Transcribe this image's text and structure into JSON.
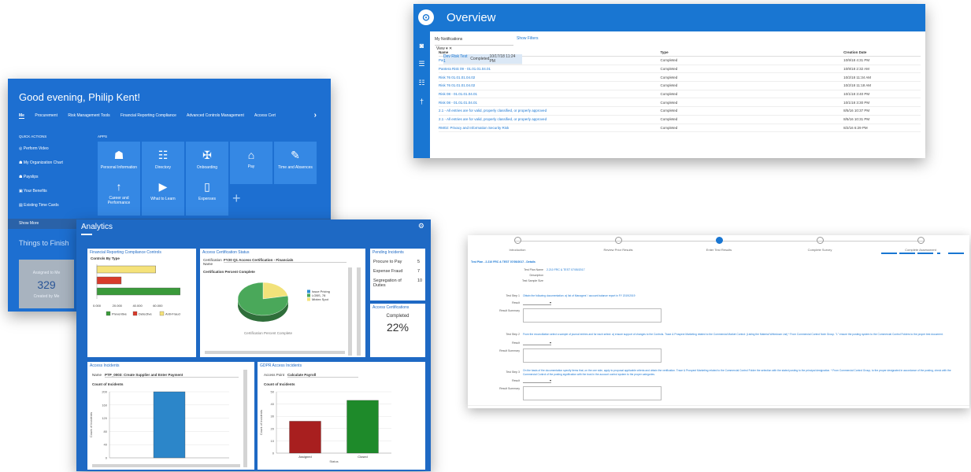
{
  "overview": {
    "title": "Overview",
    "logo_glyph": "⊙",
    "rail_icons": [
      "notification-icon",
      "list-icon",
      "group-icon",
      "person-icon"
    ],
    "rail_glyphs": [
      "◙",
      "☰",
      "☷",
      "†"
    ],
    "notifications_select": "My Notifications",
    "show_filters": "Show Filters",
    "view_label": "View ▾  ✕",
    "columns": [
      "Name",
      "Type",
      "Creation Date"
    ],
    "rows": [
      {
        "name": "Dev Risk Test 1",
        "type": "Completed",
        "date": "10/17/18 11:24 PM"
      },
      {
        "name": "Pantera Risk 08 - 01.01.01.04.01",
        "type": "Completed",
        "date": "10/9/18 4:31 PM"
      },
      {
        "name": "Pantera Risk 09 - 01.01.01.04.01",
        "type": "Completed",
        "date": "10/9/18 2:32 AM"
      },
      {
        "name": "Risk 76 01.01.01.04.02",
        "type": "Completed",
        "date": "10/2/18 11:34 AM"
      },
      {
        "name": "Risk 76 01.01.01.04.02",
        "type": "Completed",
        "date": "10/2/18 11:18 AM"
      },
      {
        "name": "Risk 08 - 01.01.01.04.01",
        "type": "Completed",
        "date": "10/1/18 3:40 PM"
      },
      {
        "name": "Risk 08 - 01.01.01.04.01",
        "type": "Completed",
        "date": "10/1/18 3:30 PM"
      },
      {
        "name": "2.1 - All entries are for valid, properly classified, or properly approved",
        "type": "Completed",
        "date": "8/5/16 10:37 PM"
      },
      {
        "name": "2.1 - All entries are for valid, properly classified, or properly approved",
        "type": "Completed",
        "date": "8/5/16 10:31 PM"
      },
      {
        "name": "RM02: Privacy and Information Security Risk",
        "type": "Completed",
        "date": "8/2/16 6:29 PM"
      }
    ]
  },
  "home": {
    "greeting": "Good evening, Philip Kent!",
    "tabs": [
      "Me",
      "Procurement",
      "Risk Management Tools",
      "Financial Reporting Compliance",
      "Advanced Controls Management",
      "Access Cert"
    ],
    "tabs_arrow": "›",
    "quick_actions_heading": "QUICK ACTIONS",
    "quick_actions": [
      {
        "label": "Perform Video",
        "icon": "◎"
      },
      {
        "label": "My Organization Chart",
        "icon": "☗"
      },
      {
        "label": "Payslips",
        "icon": "☗"
      },
      {
        "label": "Your Benefits",
        "icon": "▣"
      },
      {
        "label": "Existing Time Cards",
        "icon": "▤"
      }
    ],
    "apps_heading": "APPS",
    "tiles": [
      {
        "label": "Personal Information",
        "icon": "☗"
      },
      {
        "label": "Directory",
        "icon": "☷"
      },
      {
        "label": "Onboarding",
        "icon": "✠"
      },
      {
        "label": "Pay",
        "icon": "⌂"
      },
      {
        "label": "Time and Absences",
        "icon": "✎"
      },
      {
        "label": "Career and Performance",
        "icon": "↑"
      },
      {
        "label": "What to Learn",
        "icon": "▶"
      },
      {
        "label": "Expenses",
        "icon": "▯"
      }
    ],
    "plus": "+",
    "show_more": "Show More",
    "things_to_finish": "Things to Finish",
    "card_title": "Assigned to Me",
    "card_count": "329",
    "card_sub": "Created by Me"
  },
  "analytics": {
    "title": "Analytics",
    "gear": "⚙",
    "frc": {
      "title": "Financial Reporting Compliance Controls",
      "subtitle": "Controls By Type",
      "chart_data": {
        "type": "bar",
        "orientation": "horizontal",
        "categories": [
          "Anti-Fraud",
          "Detective",
          "Preventive"
        ],
        "series": [
          {
            "name": "Preventive",
            "values": [
              0,
              0,
              82000
            ],
            "color": "#3a9a3a"
          },
          {
            "name": "Detective",
            "values": [
              0,
              24000,
              0
            ],
            "color": "#d83a2a"
          },
          {
            "name": "Anti-Fraud",
            "values": [
              58000,
              0,
              0
            ],
            "color": "#f5e27a"
          }
        ],
        "xticks": [
          "0.000",
          "20.000",
          "40.000",
          "60.000"
        ],
        "xlim": [
          0,
          90000
        ],
        "legend": [
          "Preventive",
          "Detective",
          "Anti-Fraud"
        ]
      }
    },
    "acs": {
      "title": "Access Certification Status",
      "cert_label": "Certification Name",
      "cert_value": "FY20 Q1 Access Certification - Financials",
      "chart_title": "Certification Percent Complete",
      "chart_data": {
        "type": "pie",
        "categories": [
          "Issue Pricing",
          "LOBS, 78",
          "Mixtex Spot"
        ],
        "values": [
          22,
          78,
          0
        ],
        "colors": [
          "#2f8fd6",
          "#4aa85a",
          "#f2e27a"
        ],
        "title": "Certification Percent Complete",
        "legend_position": "right"
      },
      "footer": "Certification Percent Complete"
    },
    "pending": {
      "title": "Pending Incidents",
      "rows": [
        {
          "label": "Procure to Pay",
          "value": "5"
        },
        {
          "label": "Expense Fraud",
          "value": "7"
        },
        {
          "label": "Segregation of Duties",
          "value": "10"
        }
      ]
    },
    "access_cert": {
      "title": "Access Certifications",
      "label": "Completed",
      "value": "22%"
    },
    "access_incidents": {
      "title": "Access Incidents",
      "name_label": "Name",
      "name_value": "PTP_0003: Create Supplier and Enter Payment",
      "chart_title": "Count of Incidents",
      "chart_data": {
        "type": "bar",
        "categories": [
          ""
        ],
        "values": [
          200
        ],
        "ylabel": "Count of Incidents",
        "yticks": [
          "200",
          "160",
          "120",
          "80",
          "40",
          "0"
        ],
        "ylim": [
          0,
          200
        ],
        "color": "#2c86c9"
      }
    },
    "gdpr": {
      "title": "GDPR Access Incidents",
      "name_label": "Access Point",
      "name_value": "Calculate Payroll",
      "chart_title": "Count of Incidents",
      "chart_data": {
        "type": "bar",
        "categories": [
          "Assigned",
          "Closed"
        ],
        "values": [
          26,
          43
        ],
        "colors": [
          "#a81f1f",
          "#1e8a2a"
        ],
        "xlabel": "Status",
        "ylabel": "Count of Incidents",
        "yticks": [
          "50",
          "40",
          "30",
          "20",
          "10",
          "0"
        ],
        "ylim": [
          0,
          50
        ]
      }
    }
  },
  "testplan": {
    "steps": [
      "Introduction",
      "Review Prior Results",
      "Enter Test Results",
      "Complete Survey",
      "Complete Assessment"
    ],
    "active_step": 2,
    "section": "Test Plan - 2.210 FRC & TEST 07/05/2017 - Details",
    "fields": [
      {
        "label": "Test Plan Name",
        "value": "2.210 FRC & TEST 07/05/2017"
      },
      {
        "label": "Description",
        "value": ""
      },
      {
        "label": "Test Sample Size",
        "value": ""
      }
    ],
    "test_steps": [
      {
        "label": "Test Step 1",
        "text": "Obtain the following documentation: a) list of Managers' / account balance report in FY 2019/2019"
      },
      {
        "label": "Test Step 2",
        "text": "From the reconciliation select a sample of journal entries and for each select: a) ensure support of changes to the Controls. Trace & Prospect Marketing related to the Commercial Market Control: (Listing the Material Writedown List) * From Commercial Control Note Group. \"L\" ensure the posting system to the Commercial Control Folders to the proper test document."
      },
      {
        "label": "Test Step 3",
        "text": "On the basis of the documentation specify items that, on the one side, apply to proposal applicable criteria and obtain the verification. Trace & Prospect Marketing related to the Commercial Control Folder the selection with the stated posting to the principal designation. * From Commercial Control Group, to the proper designated in accordance of the posting, check with the Commercial Control of the posting signification with the trust in the account control system to the proper categories."
      }
    ],
    "result_label": "Result",
    "summary_label": "Result Summary",
    "dd_arrow": "▾"
  }
}
